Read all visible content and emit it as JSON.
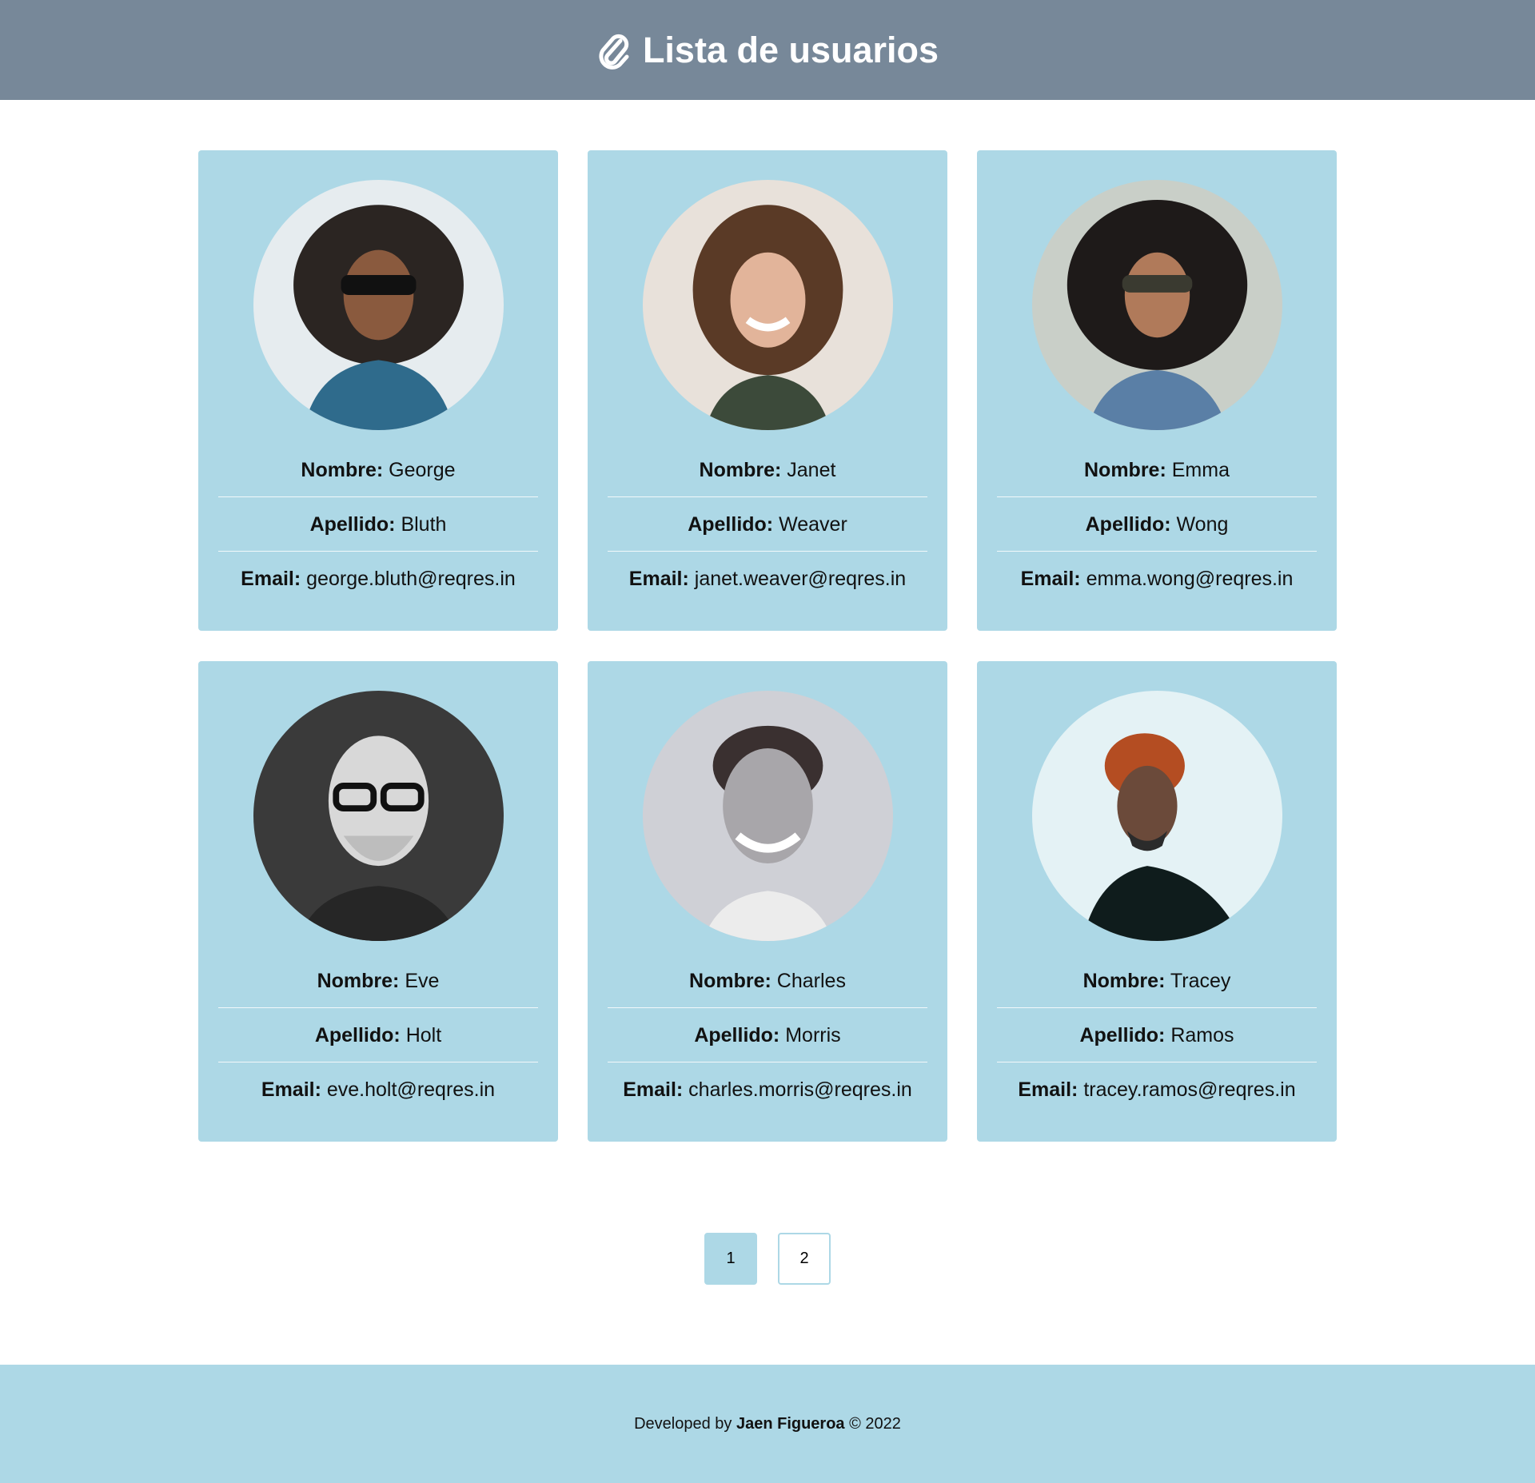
{
  "header": {
    "title": "Lista de usuarios",
    "icon": "paperclip-icon"
  },
  "colors": {
    "header_bg": "#778899",
    "card_bg": "#add8e6",
    "footer_bg": "#add8e6"
  },
  "labels": {
    "first_name": "Nombre:",
    "last_name": "Apellido:",
    "email": "Email:"
  },
  "users": [
    {
      "first_name": "George",
      "last_name": "Bluth",
      "email": "george.bluth@reqres.in",
      "avatar": "avatar-photo-george"
    },
    {
      "first_name": "Janet",
      "last_name": "Weaver",
      "email": "janet.weaver@reqres.in",
      "avatar": "avatar-photo-janet"
    },
    {
      "first_name": "Emma",
      "last_name": "Wong",
      "email": "emma.wong@reqres.in",
      "avatar": "avatar-photo-emma"
    },
    {
      "first_name": "Eve",
      "last_name": "Holt",
      "email": "eve.holt@reqres.in",
      "avatar": "avatar-photo-eve"
    },
    {
      "first_name": "Charles",
      "last_name": "Morris",
      "email": "charles.morris@reqres.in",
      "avatar": "avatar-photo-charles"
    },
    {
      "first_name": "Tracey",
      "last_name": "Ramos",
      "email": "tracey.ramos@reqres.in",
      "avatar": "avatar-photo-tracey"
    }
  ],
  "pagination": {
    "pages": [
      "1",
      "2"
    ],
    "current": "1"
  },
  "footer": {
    "prefix": "Developed by",
    "author": "Jaen Figueroa",
    "suffix": "© 2022"
  }
}
